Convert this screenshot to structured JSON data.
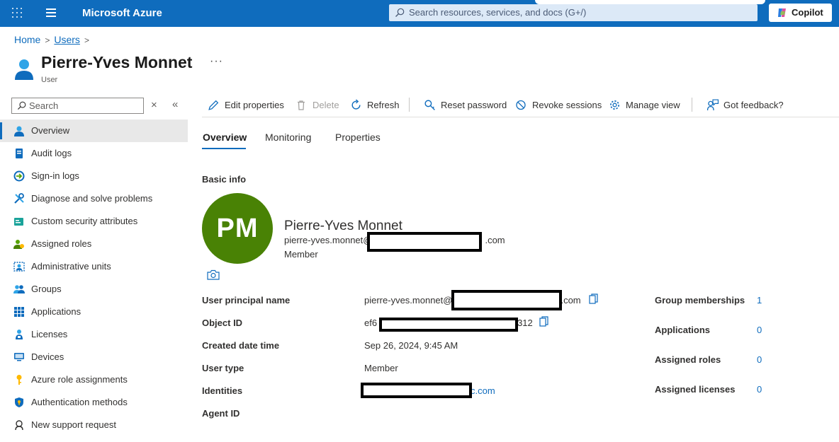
{
  "topbar": {
    "brand": "Microsoft Azure",
    "search_placeholder": "Search resources, services, and docs (G+/)",
    "copilot_label": "Copilot"
  },
  "breadcrumb": {
    "home": "Home",
    "users": "Users"
  },
  "header": {
    "title": "Pierre-Yves Monnet",
    "subtitle": "User",
    "more": "···"
  },
  "sidebar": {
    "search_placeholder": "Search",
    "close": "×",
    "collapse": "«",
    "items": [
      {
        "label": "Overview",
        "icon": "user-icon"
      },
      {
        "label": "Audit logs",
        "icon": "log-icon"
      },
      {
        "label": "Sign-in logs",
        "icon": "sign-in-icon"
      },
      {
        "label": "Diagnose and solve problems",
        "icon": "wrench-icon"
      },
      {
        "label": "Custom security attributes",
        "icon": "attributes-icon"
      },
      {
        "label": "Assigned roles",
        "icon": "roles-icon"
      },
      {
        "label": "Administrative units",
        "icon": "admin-units-icon"
      },
      {
        "label": "Groups",
        "icon": "groups-icon"
      },
      {
        "label": "Applications",
        "icon": "applications-icon"
      },
      {
        "label": "Licenses",
        "icon": "licenses-icon"
      },
      {
        "label": "Devices",
        "icon": "devices-icon"
      },
      {
        "label": "Azure role assignments",
        "icon": "key-icon"
      },
      {
        "label": "Authentication methods",
        "icon": "shield-icon"
      },
      {
        "label": "New support request",
        "icon": "support-icon"
      }
    ]
  },
  "toolbar": {
    "edit": "Edit properties",
    "delete": "Delete",
    "refresh": "Refresh",
    "reset": "Reset password",
    "revoke": "Revoke sessions",
    "manage": "Manage view",
    "feedback": "Got feedback?"
  },
  "tabs": {
    "overview": "Overview",
    "monitoring": "Monitoring",
    "properties": "Properties"
  },
  "basic_info": {
    "title": "Basic info",
    "initials": "PM",
    "name": "Pierre-Yves Monnet",
    "email_prefix": "pierre-yves.monnet@",
    "email_suffix": ".com",
    "type": "Member"
  },
  "fields": {
    "upn_label": "User principal name",
    "upn_prefix": "pierre-yves.monnet@",
    "upn_suffix": ".com",
    "object_id_label": "Object ID",
    "object_id_prefix": "ef6",
    "object_id_suffix": "312",
    "created_label": "Created date time",
    "created_value": "Sep 26, 2024, 9:45 AM",
    "user_type_label": "User type",
    "user_type_value": "Member",
    "identities_label": "Identities",
    "identities_suffix": "c.com",
    "agent_id_label": "Agent ID"
  },
  "stats": [
    {
      "label": "Group memberships",
      "value": "1"
    },
    {
      "label": "Applications",
      "value": "0"
    },
    {
      "label": "Assigned roles",
      "value": "0"
    },
    {
      "label": "Assigned licenses",
      "value": "0"
    }
  ],
  "colors": {
    "accent": "#0f6cbd",
    "avatar": "#498205"
  }
}
